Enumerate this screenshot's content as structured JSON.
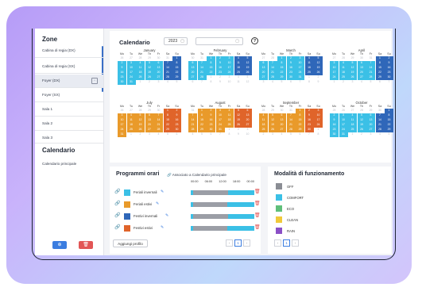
{
  "sidebar": {
    "title": "Zone",
    "items": [
      {
        "label": "Cabina di regia (DX)",
        "active": false
      },
      {
        "label": "Cabina di regia (SX)",
        "active": false
      },
      {
        "label": "Foyer (DX)",
        "active": true
      },
      {
        "label": "Foyer (SX)",
        "active": false
      },
      {
        "label": "Sala 1",
        "active": false
      },
      {
        "label": "Sala 2",
        "active": false
      },
      {
        "label": "Sala 3",
        "active": false
      }
    ],
    "calendar_title": "Calendario",
    "calendar_item": "Calendario principale",
    "add_label": "⊕",
    "delete_label": "🗑"
  },
  "calendar": {
    "title": "Calendario",
    "year": "2023",
    "search_placeholder": "",
    "help_label": "?",
    "weekdays": [
      "Mo",
      "Tu",
      "We",
      "Th",
      "Fr",
      "Sa",
      "Su"
    ],
    "months": [
      {
        "name": "January",
        "cells": "g26 g27 g28 g29 g30 g31 d1 b2 b3 b4 b5 b6 d7 d8 b9 b10 b11 b12 b13 d14 d15 b16 b17 b18 b19 b20 d21 d22 b23 b24 b25 b26 b27 d28 d29 b30 b31 g1 g2 g3 g4 g5"
      },
      {
        "name": "February",
        "cells": "g30 g31 b1 b2 b3 d4 d5 b6 b7 b8 b9 b10 d11 d12 b13 b14 b15 b16 b17 d18 d19 b20 b21 b22 b23 b24 d25 d26 b27 b28 g1 g2 g3 g4 g5 g6 g7 g8 g9 g10 g11 g12"
      },
      {
        "name": "March",
        "cells": "g27 g28 b1 b2 b3 d4 d5 b6 b7 b8 b9 b10 d11 d12 b13 b14 b15 b16 b17 d18 d19 b20 b21 b22 b23 b24 d25 d26 b27 b28 b29 b30 b31 g1 g2 g3 g4 g5 g6 g7 g8 g9"
      },
      {
        "name": "April",
        "cells": "g27 g28 g29 g30 g31 d1 d2 b3 b4 b5 b6 b7 d8 d9 b10 b11 b12 b13 b14 d15 d16 b17 b18 b19 b20 b21 d22 d23 b24 b25 b26 b27 b28 d29 d30 g1 g2 g3 g4 g5 g6 g7"
      },
      {
        "name": "July",
        "cells": "g26 g27 g28 g29 g30 r1 r2 o3 o4 o5 o6 o7 r8 r9 o10 o11 o12 o13 o14 r15 r16 o17 o18 o19 o20 o21 r22 r23 o24 o25 o26 o27 o28 r29 r30 o31 g1 g2 g3 g4 g5 g6"
      },
      {
        "name": "August",
        "cells": "g31 o1 o2 o3 o4 r5 r6 o7 o8 o9 o10 o11 r12 r13 o14 o15 o16 o17 o18 r19 r20 o21 o22 o23 o24 o25 r26 r27 o28 o29 o30 o31 g1 g2 g3 g4 g5 g6 g7 g8 g9 g10"
      },
      {
        "name": "September",
        "cells": "g28 g29 g30 g31 o1 r2 r3 o4 o5 o6 o7 o8 r9 r10 o11 o12 o13 o14 o15 r16 r17 o18 o19 o20 o21 o22 r23 r24 o25 o26 o27 o28 o29 r30 g1 g2 g3 g4 g5 g6 g7 g8"
      },
      {
        "name": "October",
        "cells": "g25 g26 g27 g28 g29 g30 d1 b2 b3 b4 b5 b6 d7 d8 b9 b10 b11 b12 b13 d14 d15 b16 b17 b18 b19 b20 d21 d22 b23 b24 b25 b26 b27 d28 d29 b30 b31 g1 g2 g3 g4 g5"
      }
    ]
  },
  "programs": {
    "title": "Programmi orari",
    "assoc_label": "Associato a Calendario principale",
    "times": [
      "00:00",
      "06:00",
      "12:00",
      "18:00",
      "00:00"
    ],
    "rows": [
      {
        "name": "Feriali invernali",
        "color": "#3bc0e6",
        "segments": [
          {
            "color": "#3bc0e6",
            "frac": 0.04
          },
          {
            "color": "#9b9ea6",
            "frac": 0.55
          },
          {
            "color": "#3bc0e6",
            "frac": 0.41
          }
        ]
      },
      {
        "name": "Feriali estivi",
        "color": "#e99a2a",
        "segments": [
          {
            "color": "#3bc0e6",
            "frac": 0.04
          },
          {
            "color": "#9b9ea6",
            "frac": 0.53
          },
          {
            "color": "#3bc0e6",
            "frac": 0.43
          }
        ]
      },
      {
        "name": "Festivi invernali",
        "color": "#2f67b9",
        "segments": [
          {
            "color": "#3bc0e6",
            "frac": 0.04
          },
          {
            "color": "#9b9ea6",
            "frac": 0.55
          },
          {
            "color": "#3bc0e6",
            "frac": 0.41
          }
        ]
      },
      {
        "name": "Festivi estivi",
        "color": "#e0642a",
        "segments": [
          {
            "color": "#3bc0e6",
            "frac": 0.04
          },
          {
            "color": "#9b9ea6",
            "frac": 0.53
          },
          {
            "color": "#3bc0e6",
            "frac": 0.43
          }
        ]
      }
    ],
    "add_label": "Aggiungi profilo",
    "pager": {
      "prev": "‹",
      "page": "1",
      "next": "›"
    }
  },
  "modes": {
    "title": "Modalità di funzionamento",
    "items": [
      {
        "label": "OFF",
        "color": "#8a8d94"
      },
      {
        "label": "COMFORT",
        "color": "#3bc0e6"
      },
      {
        "label": "ECO",
        "color": "#5fbf7a"
      },
      {
        "label": "CLEAN",
        "color": "#f0c93a"
      },
      {
        "label": "RAIN",
        "color": "#8a4fc6"
      }
    ],
    "pager": {
      "prev": "‹",
      "page": "1",
      "next": "›"
    }
  }
}
